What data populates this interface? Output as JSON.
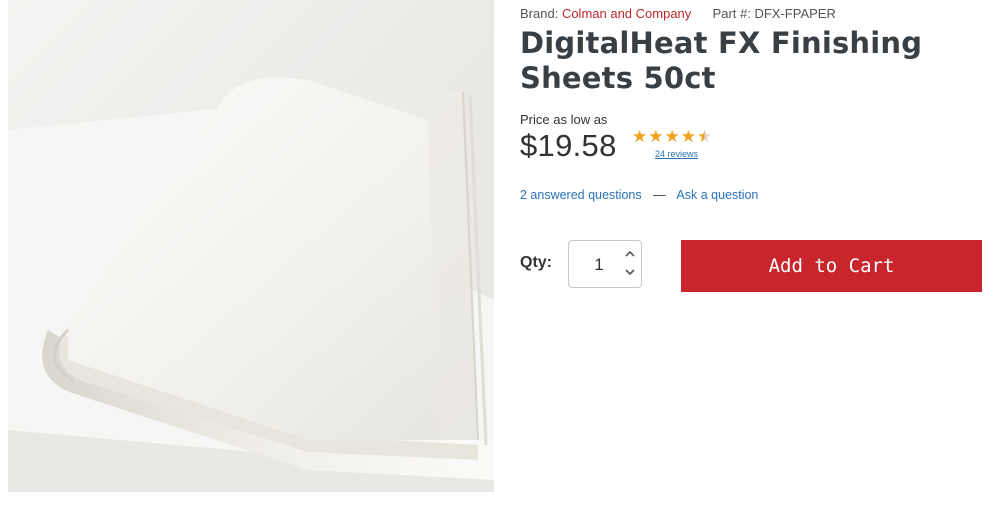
{
  "product": {
    "brand_label": "Brand:",
    "brand_name": "Colman and Company",
    "part_label": "Part #:",
    "part_number": "DFX-FPAPER",
    "title": "DigitalHeat FX Finishing Sheets 50ct",
    "image_icon": "paper-sheets-photo"
  },
  "pricing": {
    "label": "Price as low as",
    "price": "$19.58"
  },
  "rating": {
    "stars": 4.5,
    "max": 5,
    "reviews_text": "24 reviews",
    "color": "#f0a21b"
  },
  "questions": {
    "answered": "2 answered questions",
    "separator": "—",
    "ask": "Ask a question"
  },
  "purchase": {
    "qty_label": "Qty:",
    "qty_value": "1",
    "add_to_cart": "Add to Cart",
    "button_color": "#c8262c"
  }
}
